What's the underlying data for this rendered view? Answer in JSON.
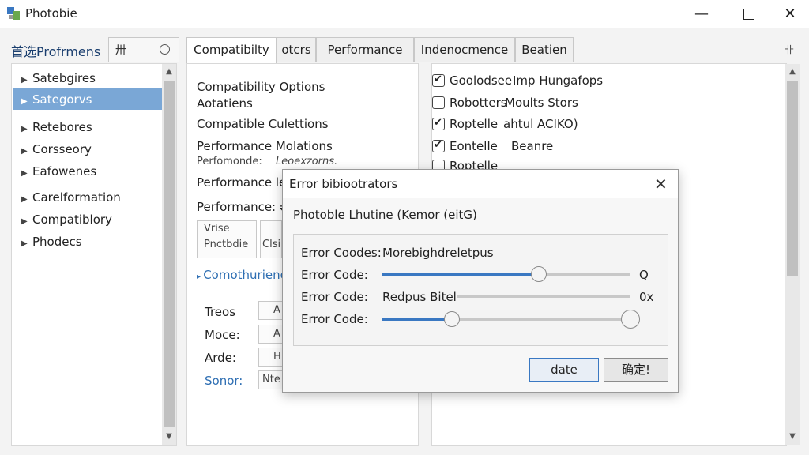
{
  "window": {
    "title": "Photobie"
  },
  "colors": {
    "accent": "#3a78c2",
    "selection": "#7aa7d6"
  },
  "header": {
    "prefs_label": "首选Profrmens",
    "search_glyph": "卅"
  },
  "tabs": [
    "Compatibilty",
    "otcrs",
    "Performance",
    "Indenocmence",
    "Beatien"
  ],
  "tabs_right_glyph": "卝",
  "sidebar": {
    "items": [
      {
        "label": "Satebgires"
      },
      {
        "label": "Sategorvs",
        "selected": true
      },
      {
        "label": "Retebores"
      },
      {
        "label": "Corsseory"
      },
      {
        "label": "Eafowenes"
      },
      {
        "label": "Carelformation"
      },
      {
        "label": "Compatiblory"
      },
      {
        "label": "Phodecs"
      }
    ]
  },
  "left_panel": {
    "heading1": "Compatibility Options",
    "heading2": "Aotatiens",
    "item1": "Compatible Culettions",
    "item2": "Performance Molations",
    "item3_label": "Perfomonde:",
    "item3_value": "Leoexzorns.",
    "item4": "Performance le",
    "item5": "Performance: ⇌",
    "box_line1": "Vrise",
    "box_line2": "Pnctbdie",
    "box_side": "Clsi",
    "link": "Comothurienc",
    "rows": [
      {
        "label": "Treos",
        "value": "A"
      },
      {
        "label": "Moce:",
        "value": "A"
      },
      {
        "label": "Arde:",
        "value": "H"
      },
      {
        "label": "Sonor:",
        "value": "Nte"
      }
    ]
  },
  "right_panel": {
    "items": [
      {
        "label": "Goolodsee",
        "value": "Imp Hungafops",
        "checked": true
      },
      {
        "label": "Robotters",
        "value": "Moults Stors",
        "checked": false
      },
      {
        "label": "Roptelle",
        "value": "ahtul ACIKO)",
        "checked": true
      },
      {
        "label": "Eontelle",
        "value": "Beanre",
        "checked": true
      },
      {
        "label": "Roptelle",
        "value": "",
        "checked": false
      }
    ]
  },
  "dialog": {
    "title": "Error bibiootrators",
    "subtitle": "Photoble Lhutine (Kemor (eitG)",
    "rows": [
      {
        "label": "Error Coodes:",
        "value": "Morebighdreletpus"
      },
      {
        "label": "Error Code:",
        "end": "Q",
        "level": 0.63
      },
      {
        "label": "Error Code:",
        "value": "Redpus Bitel",
        "end": "0x",
        "level": 0
      },
      {
        "label": "Error Code:",
        "end": "",
        "level": 0.28,
        "level2": 1.0
      }
    ],
    "ok_label": "date",
    "confirm_label": "确定!"
  }
}
